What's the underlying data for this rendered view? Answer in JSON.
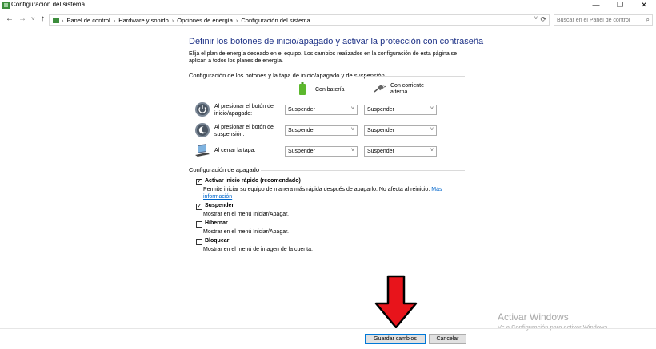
{
  "window": {
    "title": "Configuración del sistema",
    "minimize": "—",
    "maximize": "❐",
    "close": "✕"
  },
  "nav": {
    "back": "←",
    "forward": "→",
    "recent": "˅",
    "up": "↑",
    "breadcrumbs": [
      "Panel de control",
      "Hardware y sonido",
      "Opciones de energía",
      "Configuración del sistema"
    ],
    "separator": "›",
    "dropdown": "˅",
    "refresh": "⟳",
    "search_placeholder": "Buscar en el Panel de control",
    "search_icon": "⌕"
  },
  "main": {
    "heading": "Definir los botones de inicio/apagado y activar la protección con contraseña",
    "intro": "Elija el plan de energía deseado en el equipo. Los cambios realizados en la configuración de esta página se aplican a todos los planes de energía.",
    "buttons_section": "Configuración de los botones y la tapa de inicio/apagado y de suspensión",
    "col_battery": "Con batería",
    "col_ac": "Con corriente alterna",
    "rows": [
      {
        "label": "Al presionar el botón de inicio/apagado:",
        "battery": "Suspender",
        "ac": "Suspender",
        "icon": "power-icon"
      },
      {
        "label": "Al presionar el botón de suspensión:",
        "battery": "Suspender",
        "ac": "Suspender",
        "icon": "sleep-icon"
      },
      {
        "label": "Al cerrar la tapa:",
        "battery": "Suspender",
        "ac": "Suspender",
        "icon": "laptop-lid-icon"
      }
    ],
    "shutdown_section": "Configuración de apagado",
    "options": [
      {
        "label": "Activar inicio rápido (recomendado)",
        "checked": true,
        "desc": "Permite iniciar su equipo de manera más rápida después de apagarlo. No afecta al reinicio.",
        "link": "Más información"
      },
      {
        "label": "Suspender",
        "checked": true,
        "desc": "Mostrar en el menú Iniciar/Apagar."
      },
      {
        "label": "Hibernar",
        "checked": false,
        "desc": "Mostrar en el menú Iniciar/Apagar."
      },
      {
        "label": "Bloquear",
        "checked": false,
        "desc": "Mostrar en el menú de imagen de la cuenta."
      }
    ],
    "checkmark": "✓"
  },
  "watermark": {
    "line1": "Activar Windows",
    "line2": "Ve a Configuración para activar Windows."
  },
  "footer": {
    "save": "Guardar cambios",
    "cancel": "Cancelar"
  },
  "colors": {
    "heading": "#1e3287",
    "link": "#0066cc",
    "arrow": "#e8141b",
    "battery": "#5cb82d"
  }
}
